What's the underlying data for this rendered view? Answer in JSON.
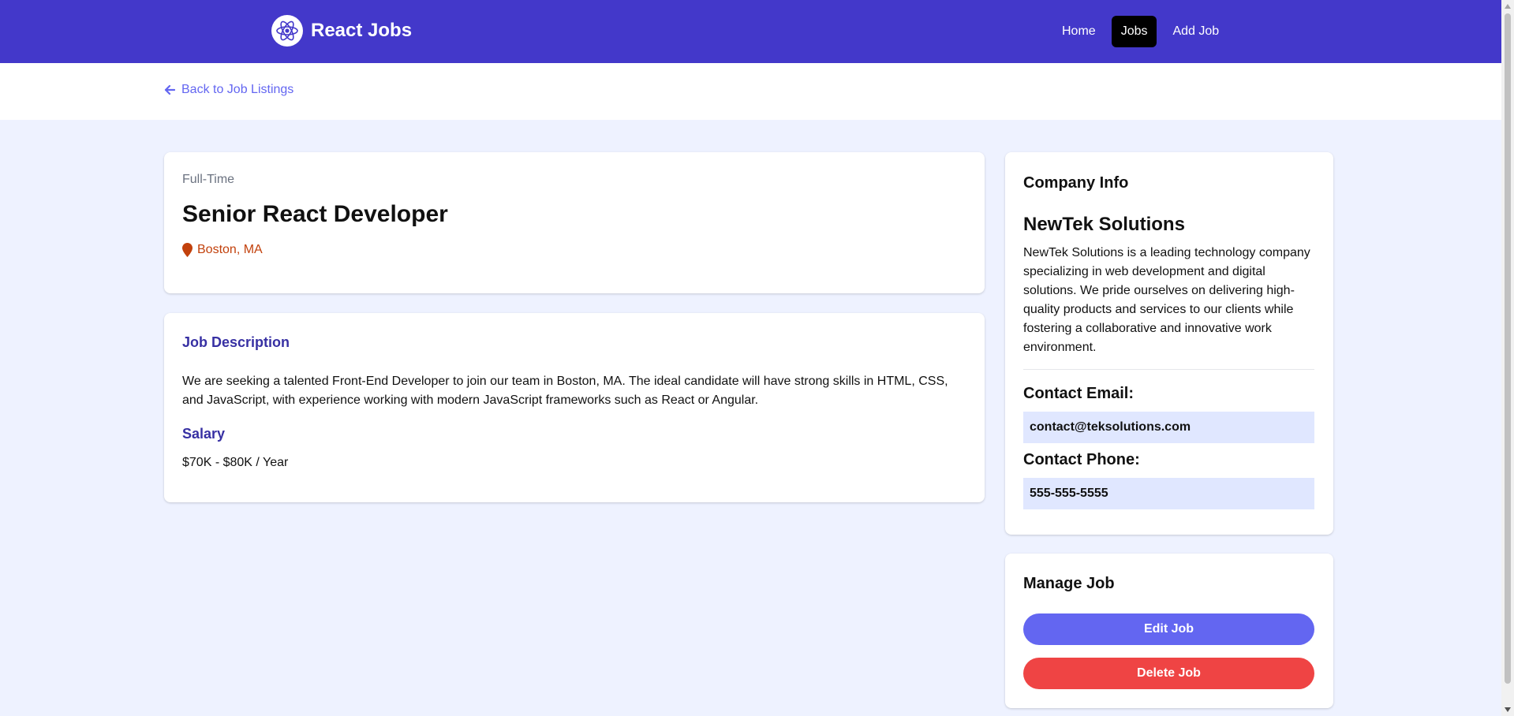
{
  "navbar": {
    "brand": "React Jobs",
    "links": [
      {
        "label": "Home",
        "active": false
      },
      {
        "label": "Jobs",
        "active": true
      },
      {
        "label": "Add Job",
        "active": false
      }
    ]
  },
  "back_link": "Back to Job Listings",
  "job": {
    "type": "Full-Time",
    "title": "Senior React Developer",
    "location": "Boston, MA",
    "description_heading": "Job Description",
    "description": "We are seeking a talented Front-End Developer to join our team in Boston, MA. The ideal candidate will have strong skills in HTML, CSS, and JavaScript, with experience working with modern JavaScript frameworks such as React or Angular.",
    "salary_heading": "Salary",
    "salary": "$70K - $80K / Year"
  },
  "company": {
    "heading": "Company Info",
    "name": "NewTek Solutions",
    "description": "NewTek Solutions is a leading technology company specializing in web development and digital solutions. We pride ourselves on delivering high-quality products and services to our clients while fostering a collaborative and innovative work environment.",
    "email_label": "Contact Email:",
    "email": "contact@teksolutions.com",
    "phone_label": "Contact Phone:",
    "phone": "555-555-5555"
  },
  "manage": {
    "heading": "Manage Job",
    "edit_label": "Edit Job",
    "delete_label": "Delete Job"
  },
  "colors": {
    "navbar": "#4338ca",
    "page_bg": "#eef2ff",
    "accent": "#6366f1",
    "danger": "#ef4444",
    "location": "#c2410c",
    "section_heading": "#3730a3",
    "contact_bg": "#e0e7ff"
  }
}
